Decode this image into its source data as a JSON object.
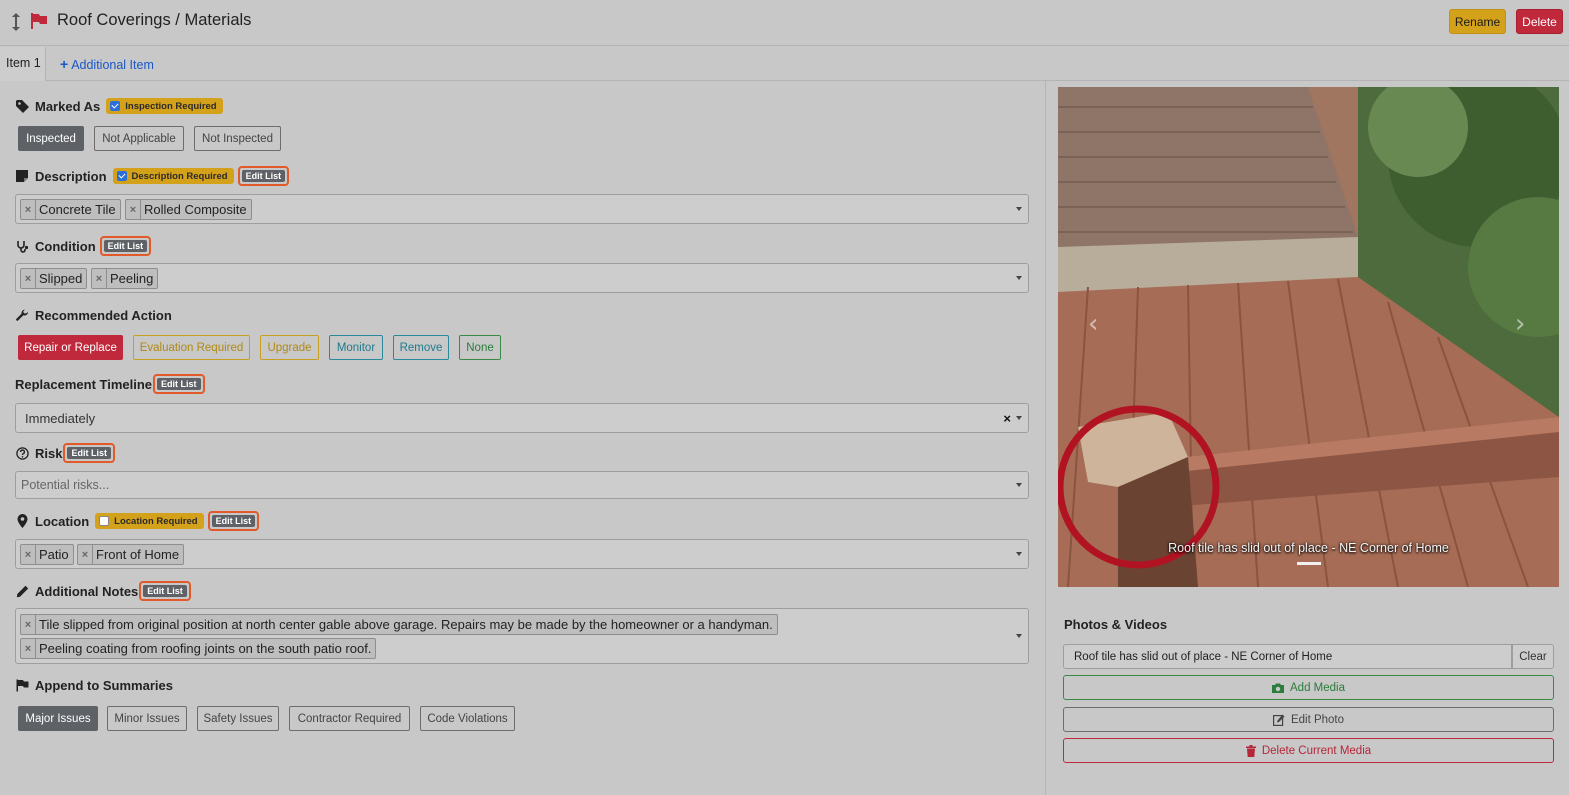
{
  "header": {
    "title": "Roof Coverings / Materials",
    "rename_label": "Rename",
    "delete_label": "Delete",
    "flag_color": "#c0283b"
  },
  "tabs": {
    "item1": "Item 1",
    "add_item": "Additional Item"
  },
  "marked_as": {
    "label": "Marked As",
    "required_label": "Inspection Required",
    "options": [
      "Inspected",
      "Not Applicable",
      "Not Inspected"
    ],
    "selected": "Inspected"
  },
  "description": {
    "label": "Description",
    "required_label": "Description Required",
    "edit_list": "Edit List",
    "values": [
      "Concrete Tile",
      "Rolled Composite"
    ]
  },
  "condition": {
    "label": "Condition",
    "edit_list": "Edit List",
    "values": [
      "Slipped",
      "Peeling"
    ]
  },
  "recommended_action": {
    "label": "Recommended Action",
    "options": [
      "Repair or Replace",
      "Evaluation Required",
      "Upgrade",
      "Monitor",
      "Remove",
      "None"
    ],
    "selected": "Repair or Replace"
  },
  "replacement_timeline": {
    "label": "Replacement Timeline",
    "edit_list": "Edit List",
    "value": "Immediately",
    "clear": "×"
  },
  "risk": {
    "label": "Risk",
    "edit_list": "Edit List",
    "placeholder": "Potential risks..."
  },
  "location": {
    "label": "Location",
    "required_label": "Location Required",
    "edit_list": "Edit List",
    "values": [
      "Patio",
      "Front of Home"
    ]
  },
  "additional_notes": {
    "label": "Additional Notes",
    "edit_list": "Edit List",
    "values": [
      "Tile slipped from original position at north center gable above garage. Repairs may be made by the homeowner or a handyman.",
      "Peeling coating from roofing joints on the south patio roof."
    ]
  },
  "append_to_summaries": {
    "label": "Append to Summaries",
    "options": [
      "Major Issues",
      "Minor Issues",
      "Safety Issues",
      "Contractor Required",
      "Code Violations"
    ],
    "selected": "Major Issues"
  },
  "media": {
    "caption": "Roof tile has slid out of place - NE Corner of Home",
    "section_title": "Photos & Videos",
    "caption_input_value": "Roof tile has slid out of place - NE Corner of Home",
    "clear_label": "Clear",
    "add_media_label": "Add Media",
    "edit_photo_label": "Edit Photo",
    "delete_media_label": "Delete Current Media",
    "prev_icon": "‹",
    "next_icon": "›"
  }
}
